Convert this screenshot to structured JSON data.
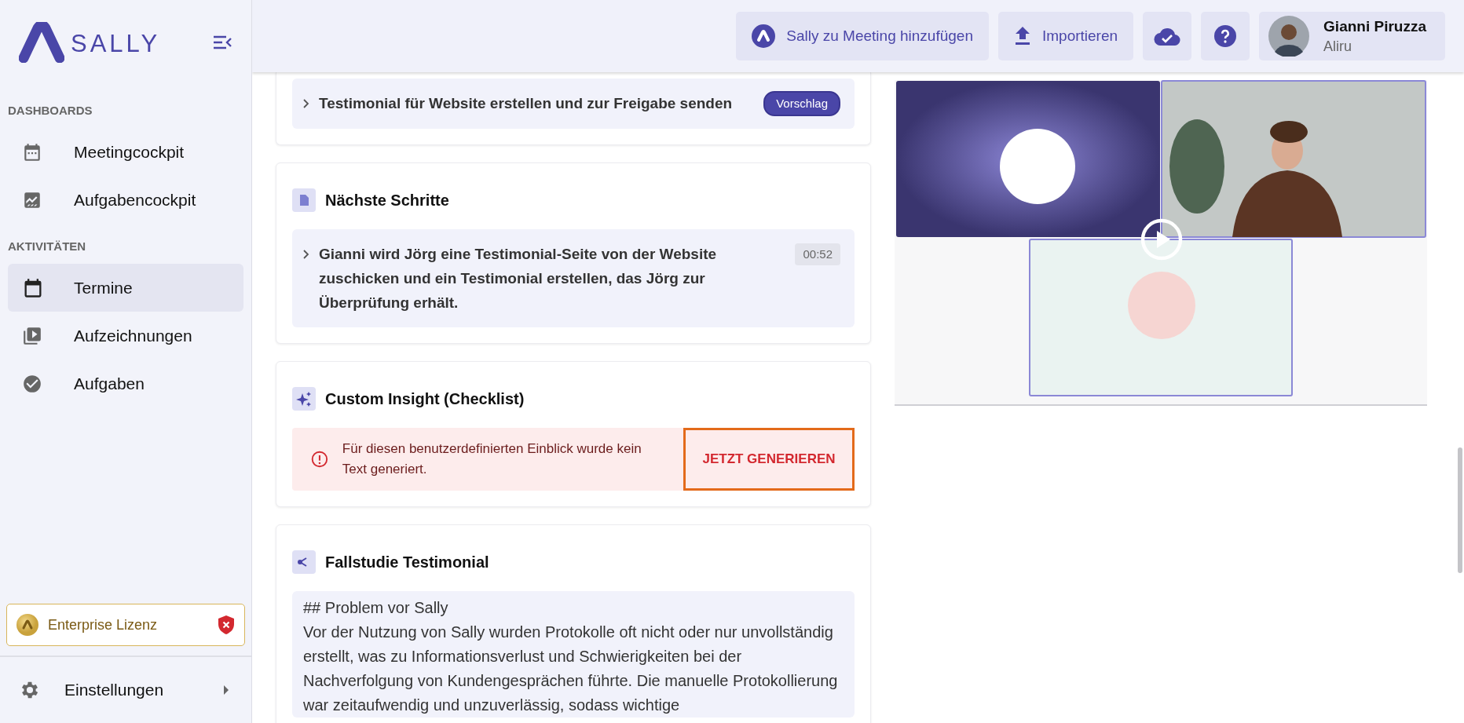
{
  "sidebar": {
    "logo": "SALLY",
    "sections": [
      {
        "heading": "DASHBOARDS",
        "items": [
          {
            "label": "Meetingcockpit",
            "selected": false
          },
          {
            "label": "Aufgabencockpit",
            "selected": false
          }
        ]
      },
      {
        "heading": "AKTIVITÄTEN",
        "items": [
          {
            "label": "Termine",
            "selected": true
          },
          {
            "label": "Aufzeichnungen",
            "selected": false
          },
          {
            "label": "Aufgaben",
            "selected": false
          }
        ]
      }
    ],
    "license": {
      "label": "Enterprise Lizenz"
    },
    "settings": {
      "label": "Einstellungen"
    }
  },
  "topbar": {
    "buttons": [
      {
        "kind": "text",
        "label": "Sally zu Meeting hinzufügen"
      },
      {
        "kind": "text",
        "label": "Importieren"
      },
      {
        "kind": "icon"
      },
      {
        "kind": "icon"
      }
    ],
    "user": {
      "name": "Gianni Piruzza",
      "organization": "Aliru"
    }
  },
  "cards": [
    {
      "kind": "list",
      "rows": [
        {
          "text": "Testimonial für Website erstellen und zur Freigabe senden",
          "badge": "Vorschlag",
          "kind": "suggestion"
        }
      ]
    },
    {
      "kind": "list",
      "title": "Nächste Schritte",
      "rows": [
        {
          "text": "Gianni wird Jörg eine Testimonial-Seite von der Website zuschicken und ein Testimonial erstellen, das Jörg zur Überprüfung erhält.",
          "badge": "00:52",
          "kind": "timestamp"
        }
      ]
    },
    {
      "kind": "alert",
      "title": "Custom Insight (Checklist)",
      "message": "Für diesen benutzerdefinierten Einblick wurde kein Text generiert.",
      "action": "JETZT GENERIEREN",
      "highlighted": true
    },
    {
      "kind": "text",
      "title": "Fallstudie Testimonial",
      "heading": "## Problem vor Sally",
      "body": "Vor der Nutzung von Sally wurden Protokolle oft nicht oder nur unvollständig erstellt, was zu Informationsverlust und Schwierigkeiten bei der Nachverfolgung von Kundengesprächen führte. Die manuelle Protokollierung war zeitaufwendig und unzuverlässig, sodass wichtige"
    }
  ]
}
